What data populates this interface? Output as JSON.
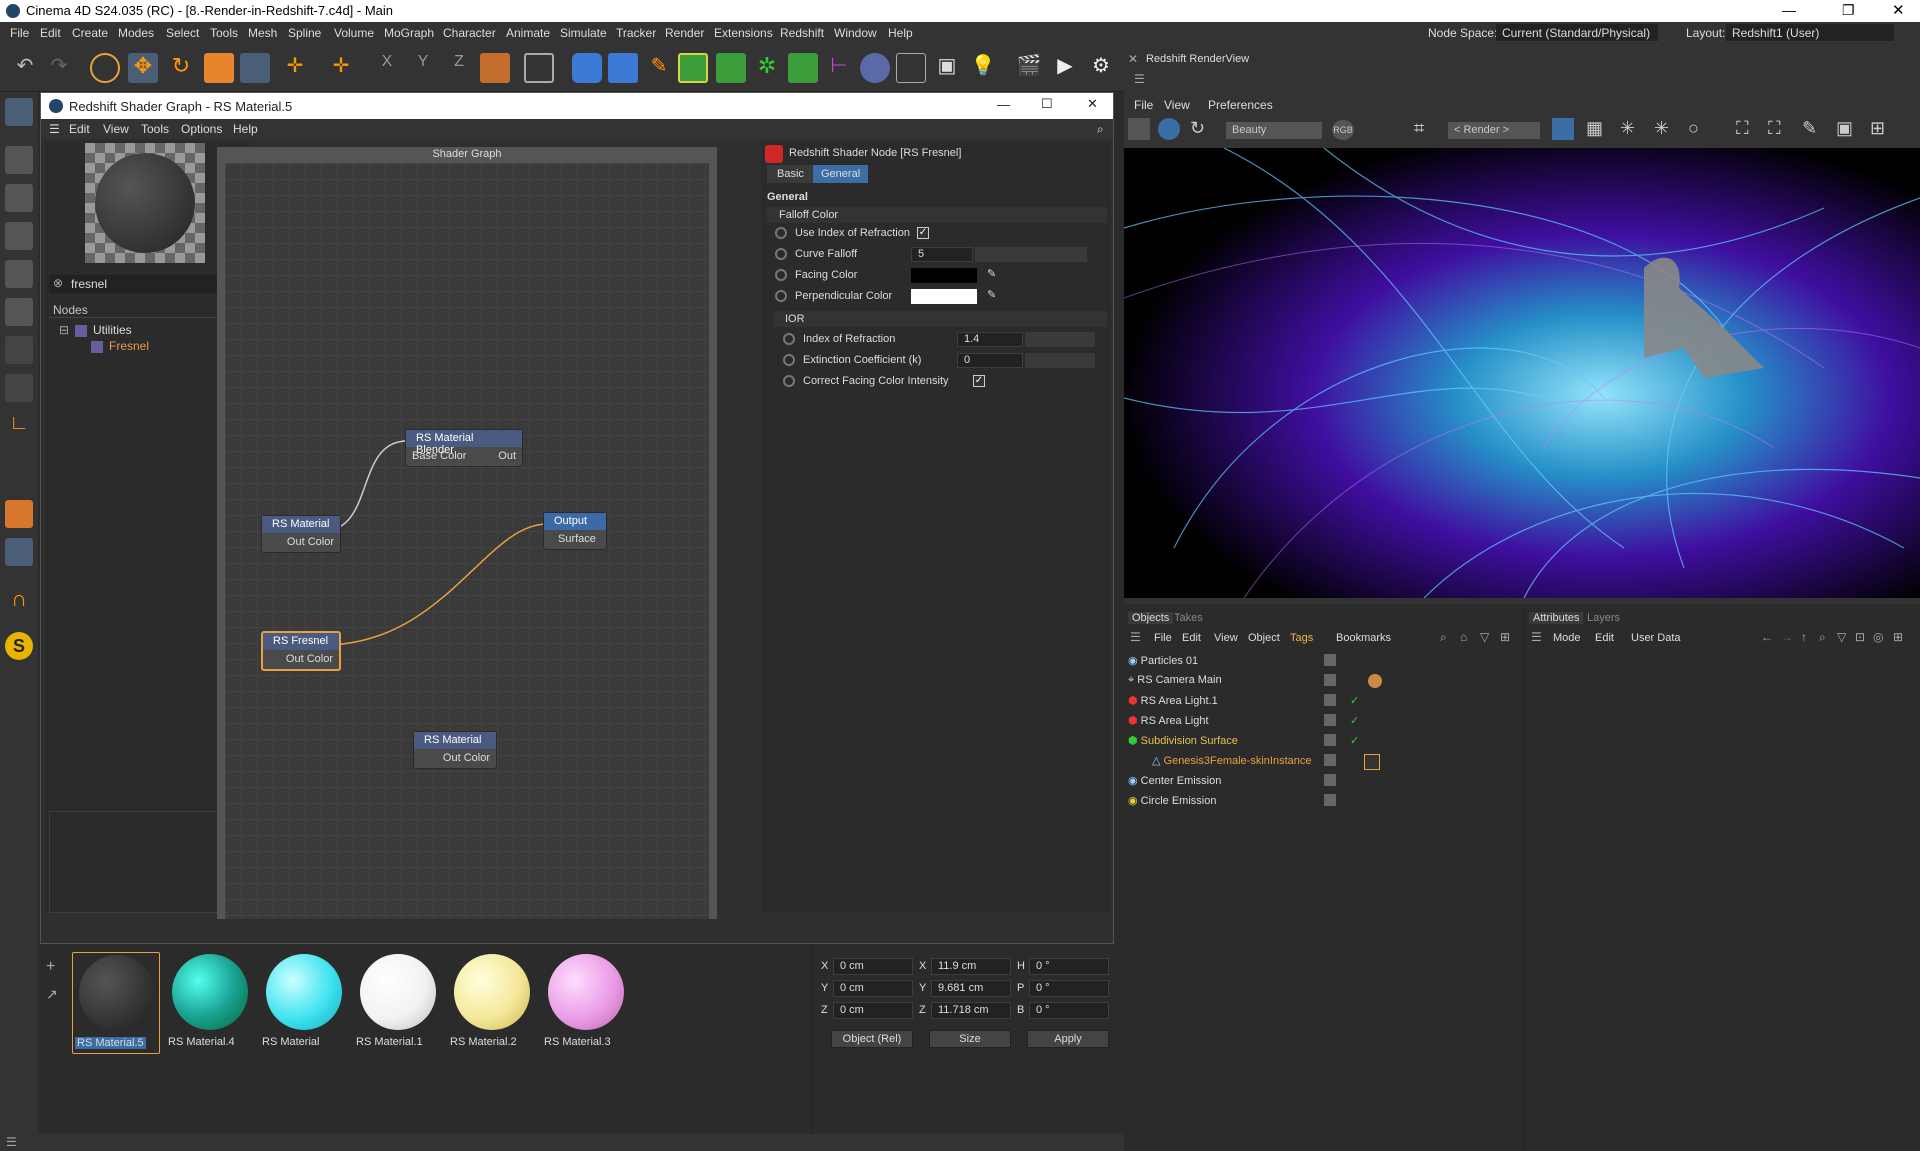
{
  "window": {
    "title": "Cinema 4D S24.035 (RC) - [8.-Render-in-Redshift-7.c4d] - Main"
  },
  "menu": [
    "File",
    "Edit",
    "Create",
    "Modes",
    "Select",
    "Tools",
    "Mesh",
    "Spline",
    "Volume",
    "MoGraph",
    "Character",
    "Animate",
    "Simulate",
    "Tracker",
    "Render",
    "Extensions",
    "Redshift",
    "Window",
    "Help"
  ],
  "nodespace": {
    "label": "Node Space:",
    "value": "Current (Standard/Physical)"
  },
  "layout": {
    "label": "Layout:",
    "value": "Redshift1 (User)"
  },
  "shadergraph": {
    "title": "Redshift Shader Graph - RS Material.5",
    "menu": [
      "Edit",
      "View",
      "Tools",
      "Options",
      "Help"
    ],
    "search": "fresnel",
    "nodes_header": "Nodes",
    "tree": {
      "group": "Utilities",
      "item": "Fresnel"
    },
    "graph_title": "Shader Graph",
    "nodes": {
      "blender": {
        "title": "RS Material Blender",
        "in": "Base Color",
        "out": "Out"
      },
      "mat1": {
        "title": "RS Material",
        "out": "Out Color"
      },
      "output": {
        "title": "Output",
        "in": "Surface"
      },
      "fresnel": {
        "title": "RS Fresnel",
        "out": "Out Color"
      },
      "mat2": {
        "title": "RS Material",
        "out": "Out Color"
      }
    }
  },
  "props": {
    "header": "Redshift Shader Node [RS Fresnel]",
    "tabs": [
      "Basic",
      "General"
    ],
    "section": "General",
    "falloff_group": "Falloff Color",
    "use_ior": "Use Index of Refraction",
    "curve_falloff": {
      "label": "Curve Falloff",
      "value": "5"
    },
    "facing": "Facing Color",
    "perp": "Perpendicular Color",
    "ior_group": "IOR",
    "ior": {
      "label": "Index of Refraction",
      "value": "1.4"
    },
    "ext": {
      "label": "Extinction Coefficient (k)",
      "value": "0"
    },
    "correct": "Correct Facing Color Intensity"
  },
  "renderview": {
    "title": "Redshift RenderView",
    "menu": [
      "File",
      "View",
      "Preferences"
    ],
    "aov": "Beauty",
    "rgb": "RGB",
    "camera": "< Render >"
  },
  "objects": {
    "tabs": [
      "Objects",
      "Takes"
    ],
    "menu": [
      "File",
      "Edit",
      "View",
      "Object",
      "Tags",
      "Bookmarks"
    ],
    "items": [
      {
        "name": "Particles 01"
      },
      {
        "name": "RS Camera Main"
      },
      {
        "name": "RS Area Light.1"
      },
      {
        "name": "RS Area Light"
      },
      {
        "name": "Subdivision Surface"
      },
      {
        "name": "Genesis3Female-skinInstance"
      },
      {
        "name": "Center Emission"
      },
      {
        "name": "Circle Emission"
      }
    ]
  },
  "attributes": {
    "tabs": [
      "Attributes",
      "Layers"
    ],
    "menu": [
      "Mode",
      "Edit",
      "User Data"
    ]
  },
  "materials": [
    {
      "name": "RS Material.5",
      "color": "#3a3a3a"
    },
    {
      "name": "RS Material.4",
      "color": "#1aa596"
    },
    {
      "name": "RS Material",
      "color": "#3fe3ef"
    },
    {
      "name": "RS Material.1",
      "color": "#f2f2f2"
    },
    {
      "name": "RS Material.2",
      "color": "#f4e89a"
    },
    {
      "name": "RS Material.3",
      "color": "#ea9ce6"
    }
  ],
  "coords": {
    "pos": {
      "x": "0 cm",
      "y": "0 cm",
      "z": "0 cm"
    },
    "size": {
      "x": "11.9 cm",
      "y": "9.681 cm",
      "z": "11.718 cm"
    },
    "rot": {
      "h": "0 °",
      "p": "0 °",
      "b": "0 °"
    },
    "mode": "Object (Rel)",
    "size_mode": "Size",
    "apply": "Apply"
  }
}
